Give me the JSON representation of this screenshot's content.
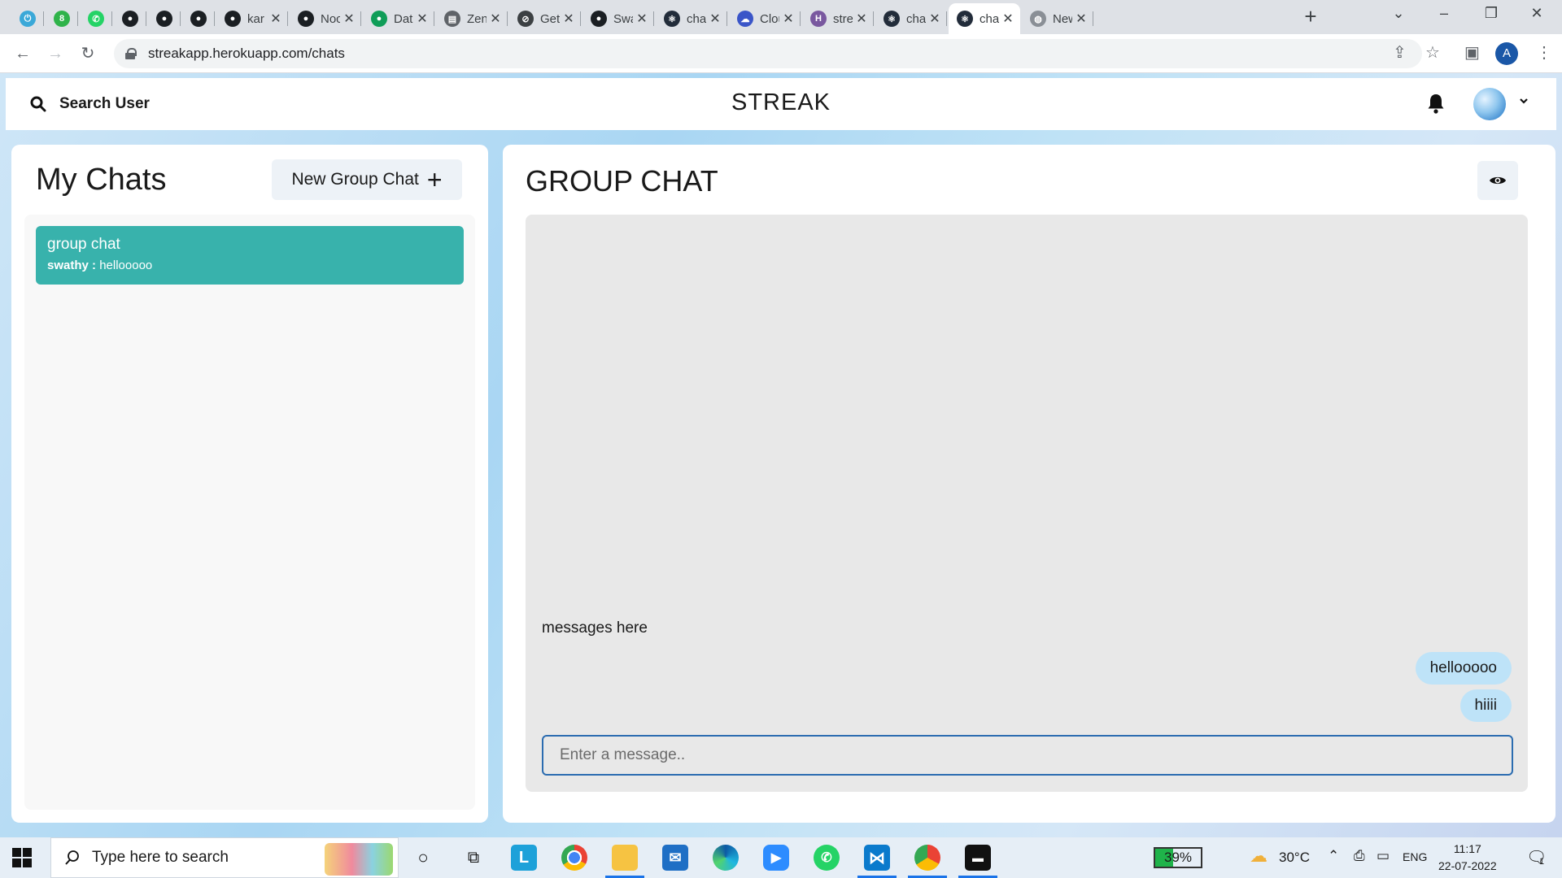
{
  "browser": {
    "tabs": [
      {
        "title": "",
        "fav_color": "#3aa8d8",
        "fav_glyph": "⏻"
      },
      {
        "title": "",
        "fav_color": "#2fb34a",
        "fav_glyph": "8"
      },
      {
        "title": "",
        "fav_color": "#25d366",
        "fav_glyph": "✆"
      },
      {
        "title": "",
        "fav_color": "#1b1f23",
        "fav_glyph": "●"
      },
      {
        "title": "",
        "fav_color": "#1b1f23",
        "fav_glyph": "●"
      },
      {
        "title": "",
        "fav_color": "#1b1f23",
        "fav_glyph": "●"
      },
      {
        "title": "kar",
        "fav_color": "#1b1f23",
        "fav_glyph": "●"
      },
      {
        "title": "Noc",
        "fav_color": "#1b1f23",
        "fav_glyph": "●"
      },
      {
        "title": "Data",
        "fav_color": "#0f9d58",
        "fav_glyph": "●"
      },
      {
        "title": "Zen",
        "fav_color": "#5f6368",
        "fav_glyph": "▤"
      },
      {
        "title": "Get",
        "fav_color": "#3c4043",
        "fav_glyph": "⊘"
      },
      {
        "title": "Swa",
        "fav_color": "#1b1f23",
        "fav_glyph": "●"
      },
      {
        "title": "chat",
        "fav_color": "#222c3a",
        "fav_glyph": "⚛"
      },
      {
        "title": "Clou",
        "fav_color": "#3a55c8",
        "fav_glyph": "☁"
      },
      {
        "title": "stre",
        "fav_color": "#79589f",
        "fav_glyph": "H"
      },
      {
        "title": "chat",
        "fav_color": "#222c3a",
        "fav_glyph": "⚛"
      },
      {
        "title": "chat",
        "fav_color": "#222c3a",
        "fav_glyph": "⚛",
        "active": true
      },
      {
        "title": "New",
        "fav_color": "#8a8f96",
        "fav_glyph": "◍"
      }
    ],
    "url": "streakapp.herokuapp.com/chats",
    "profile_initial": "A"
  },
  "header": {
    "search_label": "Search User",
    "brand": "STREAK"
  },
  "sidebar": {
    "title": "My Chats",
    "new_group_label": "New Group Chat",
    "chats": [
      {
        "name": "group chat",
        "sender": "swathy :",
        "preview": "hellooooo",
        "selected": true
      }
    ]
  },
  "chat": {
    "title": "GROUP CHAT",
    "placeholder_text": "messages here",
    "messages": [
      {
        "text": "hellooooo"
      },
      {
        "text": "hiiii"
      }
    ],
    "input_placeholder": "Enter a message.."
  },
  "taskbar": {
    "search_placeholder": "Type here to search",
    "battery": "39%",
    "battery_level": 0.39,
    "temperature": "30°C",
    "language": "ENG",
    "time": "11:17",
    "date": "22-07-2022",
    "notification_count": "1"
  },
  "colors": {
    "accent_teal": "#38b2ac",
    "bubble_blue": "#bee3f8",
    "input_border": "#2b6cb0"
  }
}
